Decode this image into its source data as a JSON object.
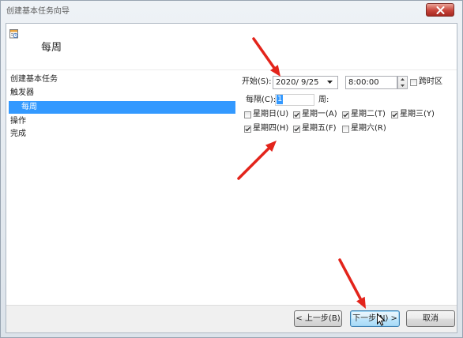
{
  "window": {
    "title": "创建基本任务向导"
  },
  "header": {
    "title": "每周"
  },
  "steps": [
    {
      "label": "创建基本任务",
      "selected": false
    },
    {
      "label": "触发器",
      "selected": false
    },
    {
      "label": "每周",
      "selected": true
    },
    {
      "label": "操作",
      "selected": false
    },
    {
      "label": "完成",
      "selected": false
    }
  ],
  "trigger": {
    "start_label": "开始(S):",
    "start_date": "2020/ 9/25",
    "start_time": "8:00:00",
    "sync_timezones": {
      "label": "跨时区",
      "checked": false
    },
    "recur_label": "每隔(C):",
    "recur_value": "1",
    "recur_unit": "周:",
    "days": [
      {
        "label": "星期日(U)",
        "checked": false
      },
      {
        "label": "星期一(A)",
        "checked": true
      },
      {
        "label": "星期二(T)",
        "checked": true
      },
      {
        "label": "星期三(Y)",
        "checked": true
      },
      {
        "label": "星期四(H)",
        "checked": true
      },
      {
        "label": "星期五(F)",
        "checked": true
      },
      {
        "label": "星期六(R)",
        "checked": false
      }
    ]
  },
  "buttons": {
    "back": "< 上一步(B)",
    "next": "下一步(N) >",
    "cancel": "取消"
  },
  "icons": {
    "header": "task-scheduler-icon",
    "close": "close-icon",
    "date_dropdown": "chevron-down-icon",
    "time_spinner": "spinner-arrows-icon",
    "checkbox_tick": "checkmark-icon",
    "cursor": "mouse-pointer-icon",
    "annotation": "red-arrow-icon"
  },
  "colors": {
    "selection": "#3399ff",
    "close_button": "#c7443a",
    "annotation_arrow": "#e3241b",
    "focused_button_border": "#3c7fb1"
  }
}
